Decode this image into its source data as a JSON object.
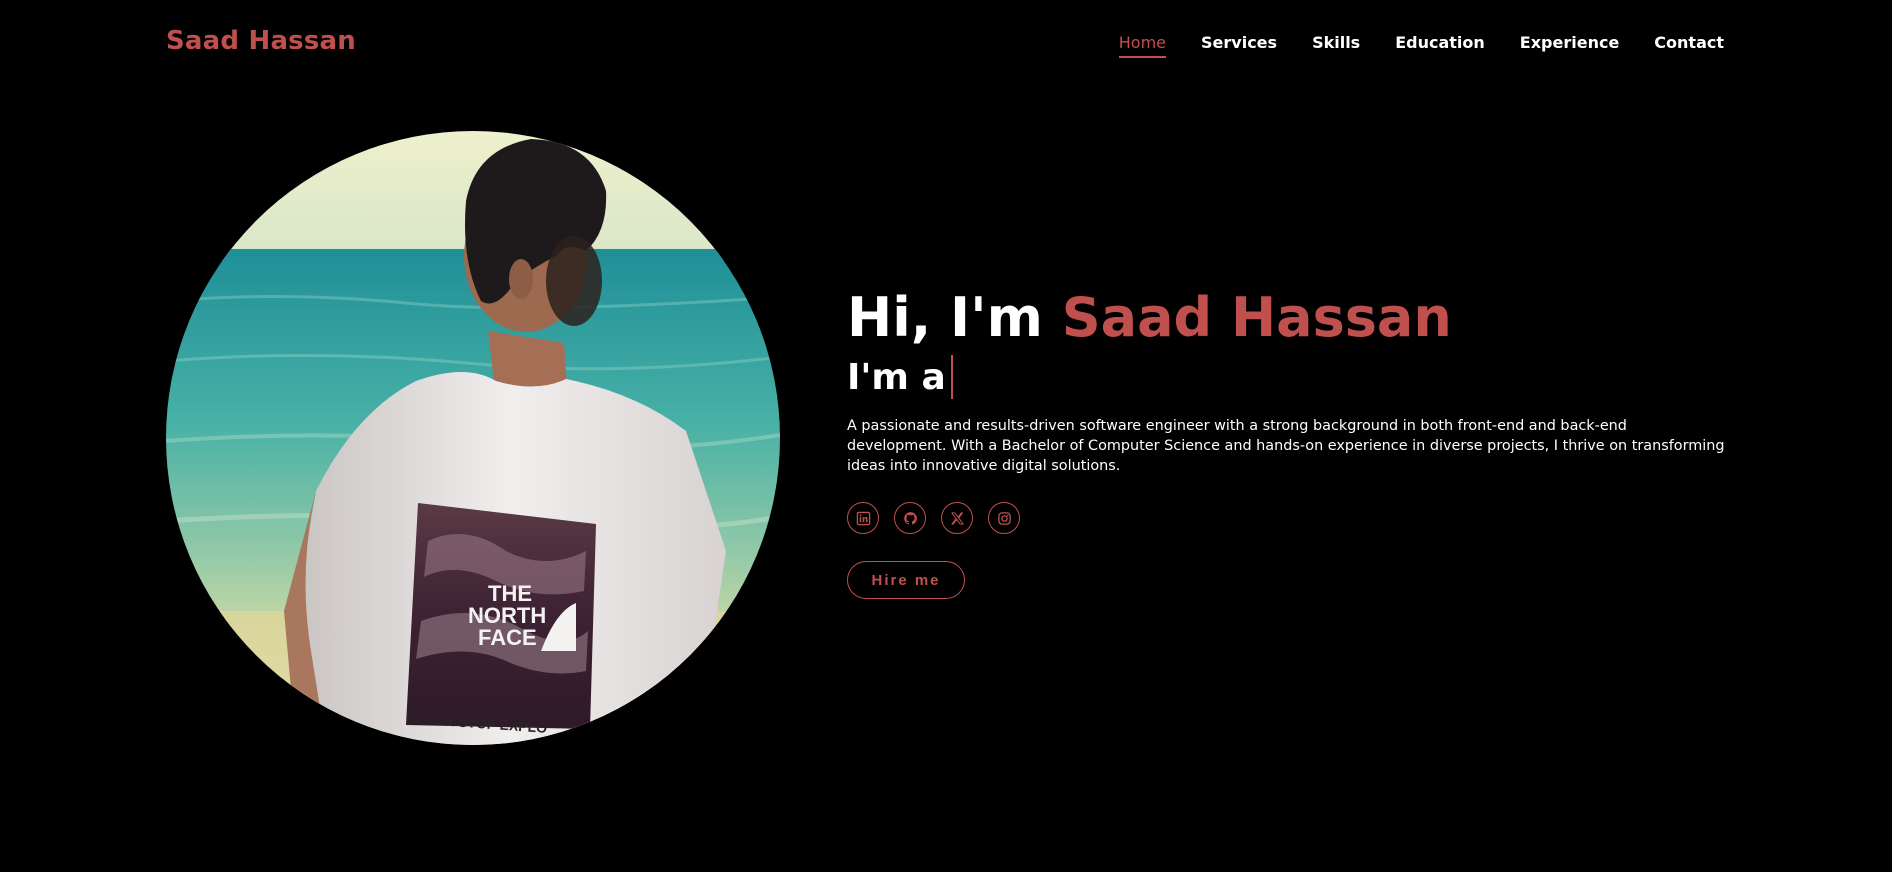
{
  "header": {
    "logo": "Saad Hassan",
    "nav": [
      {
        "label": "Home",
        "active": true
      },
      {
        "label": "Services",
        "active": false
      },
      {
        "label": "Skills",
        "active": false
      },
      {
        "label": "Education",
        "active": false
      },
      {
        "label": "Experience",
        "active": false
      },
      {
        "label": "Contact",
        "active": false
      }
    ]
  },
  "hero": {
    "greeting_prefix": "Hi, I'm",
    "greeting_name": "Saad Hassan",
    "role_prefix": "I'm a",
    "bio": "A passionate and results-driven software engineer with a strong background in both front-end and back-end development. With a Bachelor of Computer Science and hands-on experience in diverse projects, I thrive on transforming ideas into innovative digital solutions.",
    "socials": [
      "linkedin-icon",
      "github-icon",
      "x-icon",
      "instagram-icon"
    ],
    "hire_label": "Hire me"
  },
  "portrait": {
    "shirt_text": [
      "THE",
      "NORTH",
      "FACE"
    ],
    "shirt_tagline": "NEVER STOP EXPLO"
  },
  "colors": {
    "accent": "#c0504d",
    "background": "#000000",
    "text": "#ffffff"
  }
}
